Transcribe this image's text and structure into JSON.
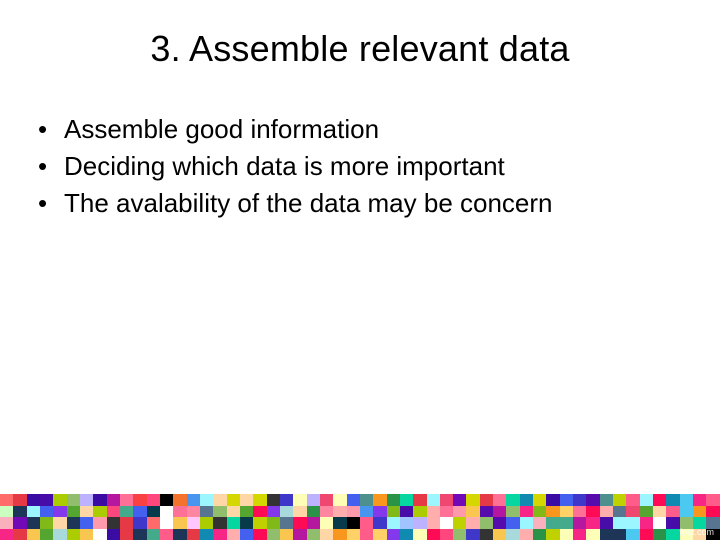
{
  "slide": {
    "title": "3. Assemble relevant data",
    "bullets": [
      "Assemble good information",
      "Deciding which data is more important",
      "The avalability of the data may be concern"
    ]
  },
  "watermark": "fppt.com",
  "mosaic": {
    "rows": 4,
    "cols": 54,
    "palette": [
      "#e63946",
      "#ff6b6b",
      "#f94144",
      "#f3722c",
      "#f8961e",
      "#f9c74f",
      "#90be6d",
      "#43aa8b",
      "#4d908e",
      "#577590",
      "#277da1",
      "#1d3557",
      "#457b9d",
      "#a8dadc",
      "#ffd166",
      "#ef476f",
      "#06d6a0",
      "#118ab2",
      "#073b4c",
      "#ffffff",
      "#ffadad",
      "#ffd6a5",
      "#fdffb6",
      "#caffbf",
      "#9bf6ff",
      "#a0c4ff",
      "#bdb2ff",
      "#ffc6ff",
      "#8338ec",
      "#3a0ca3",
      "#7209b7",
      "#f72585",
      "#b5179e",
      "#560bad",
      "#480ca8",
      "#3f37c9",
      "#4361ee",
      "#4895ef",
      "#4cc9f0",
      "#ff0a54",
      "#ff477e",
      "#ff5c8a",
      "#ff7096",
      "#ff85a1",
      "#ff99ac",
      "#fbb1bd",
      "#2b9348",
      "#55a630",
      "#80b918",
      "#aacc00",
      "#bfd200",
      "#d4d700",
      "#000000",
      "#333333"
    ]
  }
}
